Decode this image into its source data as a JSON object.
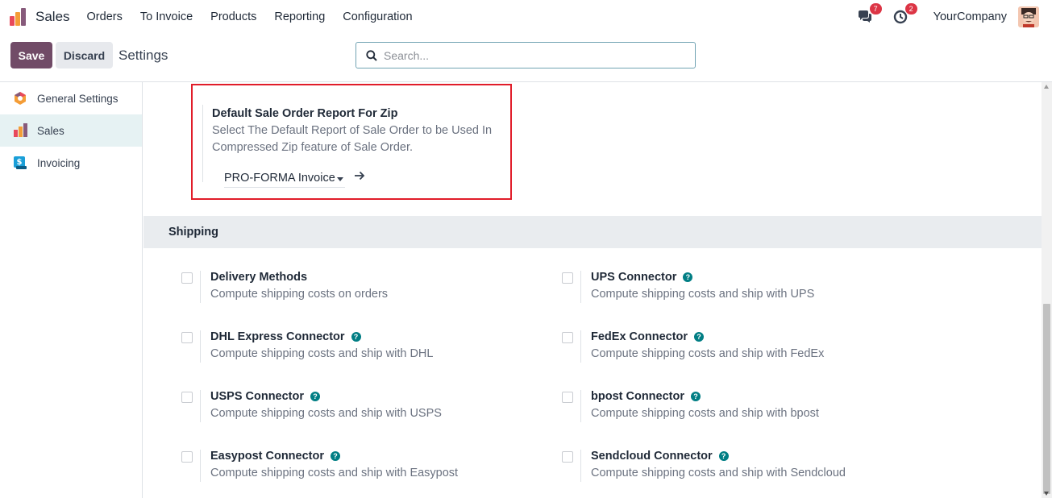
{
  "navbar": {
    "app_name": "Sales",
    "menu": [
      "Orders",
      "To Invoice",
      "Products",
      "Reporting",
      "Configuration"
    ],
    "messages_badge": "7",
    "activities_badge": "2",
    "company": "YourCompany"
  },
  "control": {
    "save_label": "Save",
    "discard_label": "Discard",
    "breadcrumb": "Settings",
    "search_placeholder": "Search..."
  },
  "sidebar": {
    "items": [
      {
        "label": "General Settings",
        "icon": "general-settings-icon",
        "active": false
      },
      {
        "label": "Sales",
        "icon": "sales-app-icon",
        "active": true
      },
      {
        "label": "Invoicing",
        "icon": "invoicing-app-icon",
        "active": false
      }
    ]
  },
  "zip_setting": {
    "title": "Default Sale Order Report For Zip",
    "description": "Select The Default Report of Sale Order to be Used In Compressed Zip feature of Sale Order.",
    "selected_value": "PRO-FORMA Invoice"
  },
  "shipping": {
    "header": "Shipping",
    "settings": [
      {
        "title": "Delivery Methods",
        "description": "Compute shipping costs on orders",
        "help": false,
        "checked": false
      },
      {
        "title": "UPS Connector",
        "description": "Compute shipping costs and ship with UPS",
        "help": true,
        "checked": false
      },
      {
        "title": "DHL Express Connector",
        "description": "Compute shipping costs and ship with DHL",
        "help": true,
        "checked": false
      },
      {
        "title": "FedEx Connector",
        "description": "Compute shipping costs and ship with FedEx",
        "help": true,
        "checked": false
      },
      {
        "title": "USPS Connector",
        "description": "Compute shipping costs and ship with USPS",
        "help": true,
        "checked": false
      },
      {
        "title": "bpost Connector",
        "description": "Compute shipping costs and ship with bpost",
        "help": true,
        "checked": false
      },
      {
        "title": "Easypost Connector",
        "description": "Compute shipping costs and ship with Easypost",
        "help": true,
        "checked": false
      },
      {
        "title": "Sendcloud Connector",
        "description": "Compute shipping costs and ship with Sendcloud",
        "help": true,
        "checked": false
      }
    ]
  },
  "colors": {
    "primary": "#714b67",
    "accent": "#017e84",
    "highlight_border": "#e11d2a"
  }
}
